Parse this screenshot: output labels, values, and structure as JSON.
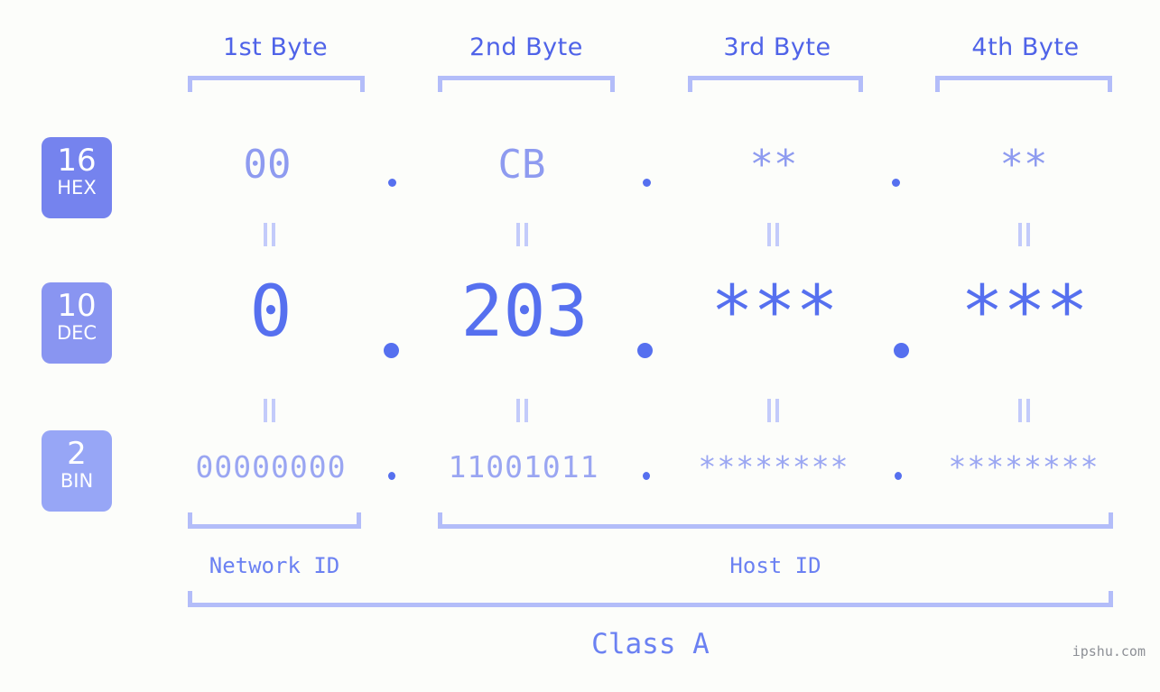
{
  "page": {
    "background_color": "#fcfdfa",
    "accent_color": "#5670ef",
    "light_accent_color": "#b3bdf9",
    "watermark": "ipshu.com"
  },
  "byte_headers": [
    {
      "label": "1st Byte"
    },
    {
      "label": "2nd Byte"
    },
    {
      "label": "3rd Byte"
    },
    {
      "label": "4th Byte"
    }
  ],
  "bases": [
    {
      "number": "16",
      "name": "HEX",
      "color": "#7583ee"
    },
    {
      "number": "10",
      "name": "DEC",
      "color": "#8995f1"
    },
    {
      "number": "2",
      "name": "BIN",
      "color": "#97a6f6"
    }
  ],
  "rows": {
    "hex": {
      "values": [
        "00",
        "CB",
        "**",
        "**"
      ]
    },
    "dec": {
      "values": [
        "0",
        "203",
        "***",
        "***"
      ]
    },
    "bin": {
      "values": [
        "00000000",
        "11001011",
        "********",
        "********"
      ]
    }
  },
  "separators": {
    "dot": "."
  },
  "equal_marks": {
    "symbol": "="
  },
  "id_groups": [
    {
      "label": "Network ID"
    },
    {
      "label": "Host ID"
    }
  ],
  "class_label": "Class A"
}
